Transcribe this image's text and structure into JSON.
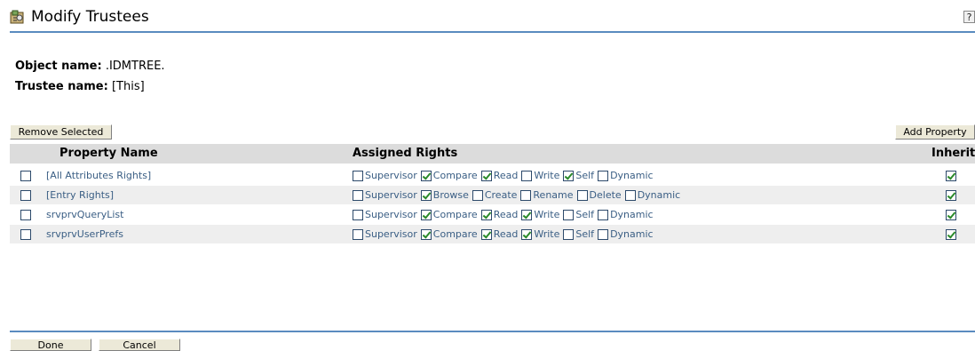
{
  "header": {
    "title": "Modify Trustees",
    "help_label": "?"
  },
  "info": {
    "object_label": "Object name:",
    "object_value": ".IDMTREE.",
    "trustee_label": "Trustee name:",
    "trustee_value": "[This]"
  },
  "toolbar": {
    "remove_label": "Remove Selected",
    "add_label": "Add Property"
  },
  "table": {
    "columns": {
      "property": "Property Name",
      "rights": "Assigned Rights",
      "inherit": "Inherit"
    },
    "rows": [
      {
        "name": "[All Attributes Rights]",
        "rights": [
          {
            "label": "Supervisor",
            "checked": false
          },
          {
            "label": "Compare",
            "checked": true
          },
          {
            "label": "Read",
            "checked": true
          },
          {
            "label": "Write",
            "checked": false
          },
          {
            "label": "Self",
            "checked": true
          },
          {
            "label": "Dynamic",
            "checked": false
          }
        ],
        "inherit": true
      },
      {
        "name": "[Entry Rights]",
        "rights": [
          {
            "label": "Supervisor",
            "checked": false
          },
          {
            "label": "Browse",
            "checked": true
          },
          {
            "label": "Create",
            "checked": false
          },
          {
            "label": "Rename",
            "checked": false
          },
          {
            "label": "Delete",
            "checked": false
          },
          {
            "label": "Dynamic",
            "checked": false
          }
        ],
        "inherit": true
      },
      {
        "name": "srvprvQueryList",
        "rights": [
          {
            "label": "Supervisor",
            "checked": false
          },
          {
            "label": "Compare",
            "checked": true
          },
          {
            "label": "Read",
            "checked": true
          },
          {
            "label": "Write",
            "checked": true
          },
          {
            "label": "Self",
            "checked": false
          },
          {
            "label": "Dynamic",
            "checked": false
          }
        ],
        "inherit": true
      },
      {
        "name": "srvprvUserPrefs",
        "rights": [
          {
            "label": "Supervisor",
            "checked": false
          },
          {
            "label": "Compare",
            "checked": true
          },
          {
            "label": "Read",
            "checked": true
          },
          {
            "label": "Write",
            "checked": true
          },
          {
            "label": "Self",
            "checked": false
          },
          {
            "label": "Dynamic",
            "checked": false
          }
        ],
        "inherit": true
      }
    ]
  },
  "footer": {
    "done_label": "Done",
    "cancel_label": "Cancel"
  },
  "colors": {
    "rule": "#5a8bbf",
    "header_bg": "#dcdcdc",
    "alt_row_bg": "#eeeeee",
    "link": "#3a5e84"
  }
}
